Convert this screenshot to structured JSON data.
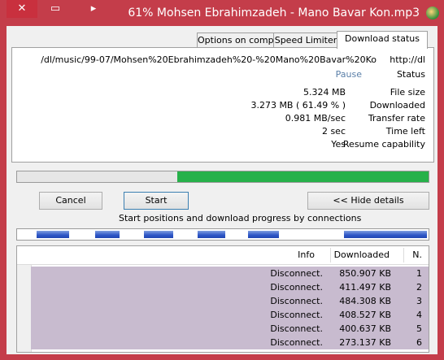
{
  "window": {
    "title": "61% Mohsen Ebrahimzadeh - Mano Bavar Kon.mp3",
    "close_glyph": "✕",
    "max_glyph": "▭",
    "min_glyph": "▸"
  },
  "tabs": [
    {
      "label": "Download status",
      "active": true
    },
    {
      "label": "Speed Limiter",
      "active": false
    },
    {
      "label": "Options on completion",
      "active": false
    }
  ],
  "details": {
    "url_label": "http://dl",
    "url_value": "/dl/music/99-07/Mohsen%20Ebrahimzadeh%20-%20Mano%20Bavar%20Ko",
    "status_label": "Status",
    "status_value": "Pause",
    "rows": [
      {
        "label": "File size",
        "value": "5.324  MB"
      },
      {
        "label": "Downloaded",
        "value": "3.273  MB  ( 61.49 % )"
      },
      {
        "label": "Transfer rate",
        "value": "0.981  MB/sec"
      },
      {
        "label": "Time left",
        "value": "2 sec"
      },
      {
        "label": "Resume capability",
        "value": "Yes"
      }
    ]
  },
  "progress": {
    "fraction": 0.61
  },
  "buttons": {
    "hide_details": "<< Hide details",
    "start": "Start",
    "cancel": "Cancel"
  },
  "connections_label": "Start positions and download progress by connections",
  "table": {
    "headers": {
      "n": "N.",
      "downloaded": "Downloaded",
      "info": "Info"
    },
    "rows": [
      {
        "n": "1",
        "downloaded": "850.907  KB",
        "info": "Disconnect."
      },
      {
        "n": "2",
        "downloaded": "411.497  KB",
        "info": "Disconnect."
      },
      {
        "n": "3",
        "downloaded": "484.308  KB",
        "info": "Disconnect."
      },
      {
        "n": "4",
        "downloaded": "408.527  KB",
        "info": "Disconnect."
      },
      {
        "n": "5",
        "downloaded": "400.637  KB",
        "info": "Disconnect."
      },
      {
        "n": "6",
        "downloaded": "273.137  KB",
        "info": "Disconnect."
      }
    ]
  }
}
